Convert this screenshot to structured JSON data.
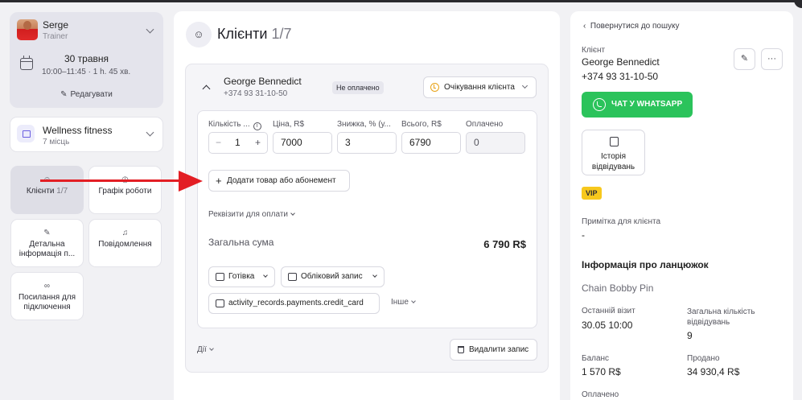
{
  "user": {
    "name": "Serge",
    "role": "Trainer"
  },
  "appointment": {
    "date": "30 травня",
    "time": "10:00–11:45 · 1 h. 45 хв.",
    "edit_label": "Редагувати"
  },
  "company": {
    "name": "Wellness fitness",
    "seats": "7 місць"
  },
  "nav": {
    "clients": {
      "label": "Клієнти",
      "count": "1/7"
    },
    "schedule": {
      "label": "Графік роботи"
    },
    "details": {
      "label": "Детальна інформація п..."
    },
    "notifications": {
      "label": "Повідомлення"
    },
    "links": {
      "label": "Посилання для підключення"
    }
  },
  "main": {
    "title": "Клієнти",
    "count": "1/7"
  },
  "client": {
    "name": "George Bennedict",
    "phone": "+374 93 31-10-50",
    "payment_badge": "Не оплачено",
    "status": "Очікування клієнта"
  },
  "item": {
    "labels": {
      "qty": "Кількість ...",
      "price": "Ціна, R$",
      "discount": "Знижка, % (у...",
      "total": "Всього, R$",
      "paid": "Оплачено"
    },
    "qty": "1",
    "price": "7000",
    "discount": "3",
    "total": "6790",
    "paid": "0",
    "minus": "−",
    "plus": "+"
  },
  "add_item_label": "Додати товар або абонемент",
  "requisites_label": "Реквізити для оплати",
  "sum": {
    "label": "Загальна сума",
    "value": "6 790 R$"
  },
  "payment": {
    "method": "Готівка",
    "account": "Обліковий запис",
    "credit": "activity_records.payments.credit_card",
    "other": "Інше"
  },
  "actions_label": "Дії",
  "delete_label": "Видалити запис",
  "right": {
    "back_label": "Повернутися до пошуку",
    "client_label": "Клієнт",
    "client_name": "George Bennedict",
    "client_phone": "+374 93 31-10-50",
    "whatsapp_label": "ЧАТ У WHATSAPP",
    "history_label": "Історія відвідувань",
    "vip": "VIP",
    "note_label": "Примітка для клієнта",
    "note_value": "-",
    "chain_title": "Інформація про ланцюжок",
    "chain_name": "Chain Bobby Pin",
    "last_visit_label": "Останній візит",
    "last_visit_value": "30.05 10:00",
    "visits_label": "Загальна кількість відвідувань",
    "visits_value": "9",
    "balance_label": "Баланс",
    "balance_value": "1 570 R$",
    "sold_label": "Продано",
    "sold_value": "34 930,4 R$",
    "paid_label": "Оплачено"
  },
  "colors": {
    "accent_green": "#2bc35b",
    "vip_yellow": "#f7c81d",
    "arrow_red": "#e31e24",
    "status_orange": "#e8a318"
  }
}
